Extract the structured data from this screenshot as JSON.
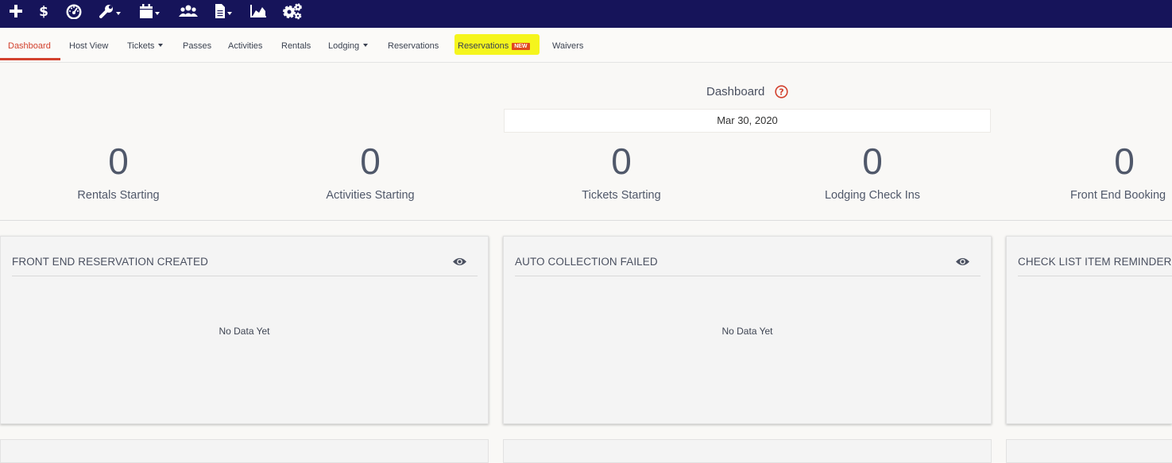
{
  "toolbar": {
    "icons": [
      "plus-icon",
      "dollar-icon",
      "dashboard-gauge-icon",
      "wrench-icon",
      "calendar-icon",
      "users-icon",
      "document-icon",
      "area-chart-icon",
      "cogs-icon"
    ],
    "background": "#16145a"
  },
  "nav": {
    "items": [
      {
        "label": "Dashboard",
        "active": true
      },
      {
        "label": "Host View"
      },
      {
        "label": "Tickets",
        "dropdown": true
      },
      {
        "label": "Passes"
      },
      {
        "label": "Activities"
      },
      {
        "label": "Rentals"
      },
      {
        "label": "Lodging",
        "dropdown": true
      },
      {
        "label": "Reservations"
      },
      {
        "label": "Reservations",
        "badge": "NEW",
        "highlighted": true
      },
      {
        "label": "Waivers"
      }
    ],
    "active_color": "#d2402d",
    "highlight_color": "#f5f51d"
  },
  "dashboard": {
    "title": "Dashboard",
    "date": "Mar 30, 2020"
  },
  "stats": [
    {
      "value": "0",
      "label": "Rentals Starting"
    },
    {
      "value": "0",
      "label": "Activities Starting"
    },
    {
      "value": "0",
      "label": "Tickets Starting"
    },
    {
      "value": "0",
      "label": "Lodging Check Ins"
    },
    {
      "value": "0",
      "label": "Front End Booking"
    }
  ],
  "cards": [
    {
      "title": "FRONT END RESERVATION CREATED",
      "empty_text": "No Data Yet"
    },
    {
      "title": "AUTO COLLECTION FAILED",
      "empty_text": "No Data Yet"
    },
    {
      "title": "CHECK LIST ITEM REMINDER"
    }
  ]
}
